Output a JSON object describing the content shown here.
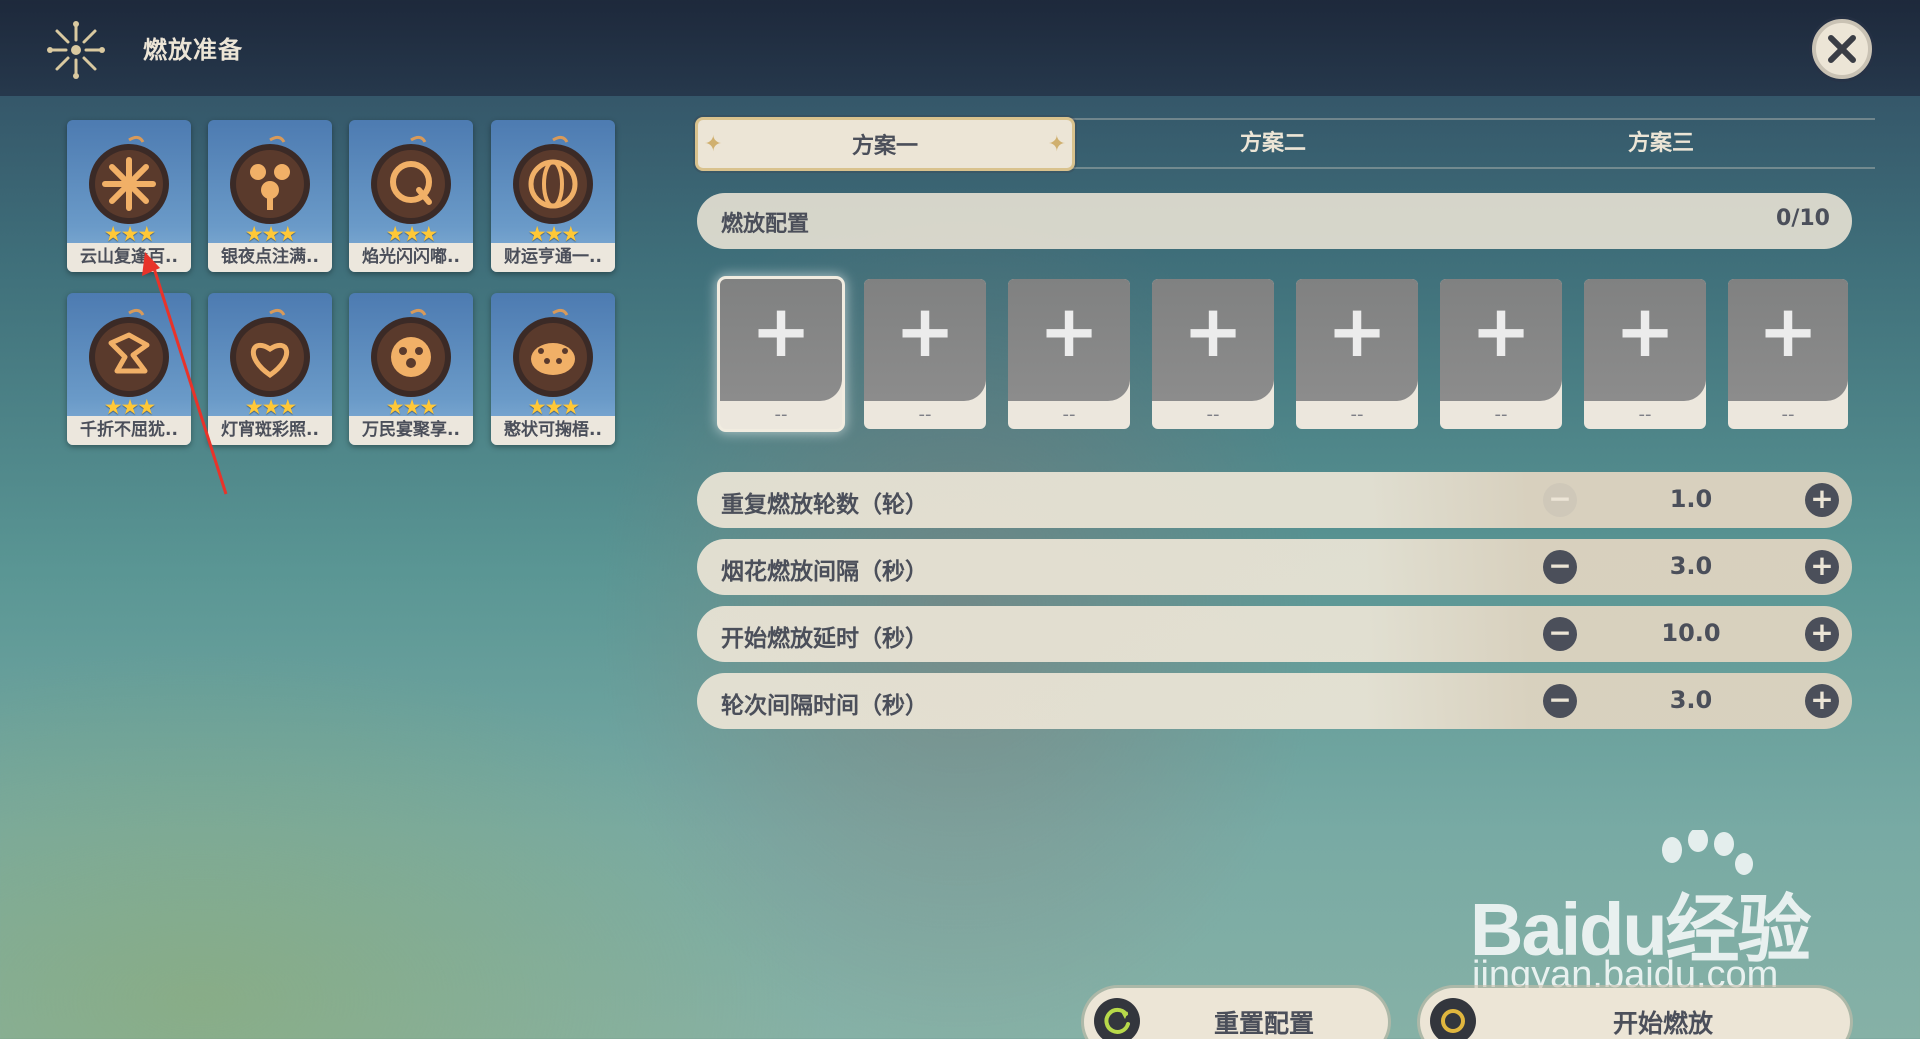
{
  "header": {
    "title": "燃放准备"
  },
  "fireworks": [
    {
      "name": "云山复逢百..",
      "stars": "★★★",
      "glyph": "pinwheel"
    },
    {
      "name": "银夜点注满..",
      "stars": "★★★",
      "glyph": "spray"
    },
    {
      "name": "焰光闪闪嘟..",
      "stars": "★★★",
      "glyph": "ghost"
    },
    {
      "name": "财运亨通一..",
      "stars": "★★★",
      "glyph": "coin"
    },
    {
      "name": "千折不屈犹..",
      "stars": "★★★",
      "glyph": "fold"
    },
    {
      "name": "灯宵斑彩照..",
      "stars": "★★★",
      "glyph": "heart"
    },
    {
      "name": "万民宴聚享..",
      "stars": "★★★",
      "glyph": "bun"
    },
    {
      "name": "憨状可掬梧..",
      "stars": "★★★",
      "glyph": "pig"
    }
  ],
  "tabs": [
    {
      "label": "方案一",
      "active": true
    },
    {
      "label": "方案二",
      "active": false
    },
    {
      "label": "方案三",
      "active": false
    }
  ],
  "config": {
    "label": "燃放配置",
    "count": "0/10"
  },
  "slots": [
    {
      "plus": "+",
      "dash": "--",
      "selected": true
    },
    {
      "plus": "+",
      "dash": "--",
      "selected": false
    },
    {
      "plus": "+",
      "dash": "--",
      "selected": false
    },
    {
      "plus": "+",
      "dash": "--",
      "selected": false
    },
    {
      "plus": "+",
      "dash": "--",
      "selected": false
    },
    {
      "plus": "+",
      "dash": "--",
      "selected": false
    },
    {
      "plus": "+",
      "dash": "--",
      "selected": false
    },
    {
      "plus": "+",
      "dash": "--",
      "selected": false
    }
  ],
  "settings": [
    {
      "label": "重复燃放轮数（轮）",
      "value": "1.0",
      "minus_disabled": true
    },
    {
      "label": "烟花燃放间隔（秒）",
      "value": "3.0",
      "minus_disabled": false
    },
    {
      "label": "开始燃放延时（秒）",
      "value": "10.0",
      "minus_disabled": false
    },
    {
      "label": "轮次间隔时间（秒）",
      "value": "3.0",
      "minus_disabled": false
    }
  ],
  "controls": {
    "minus_symbol": "−",
    "plus_symbol": "+"
  },
  "actions": {
    "reset_label": "重置配置",
    "start_label": "开始燃放"
  },
  "watermark": {
    "logo_text": "Baidu经验",
    "url": "jingyan.baidu.com"
  },
  "colors": {
    "accent_text": "#4b4f5a",
    "panel": "#ece5d6",
    "star": "#ffc837",
    "gold": "#d0b06f"
  }
}
